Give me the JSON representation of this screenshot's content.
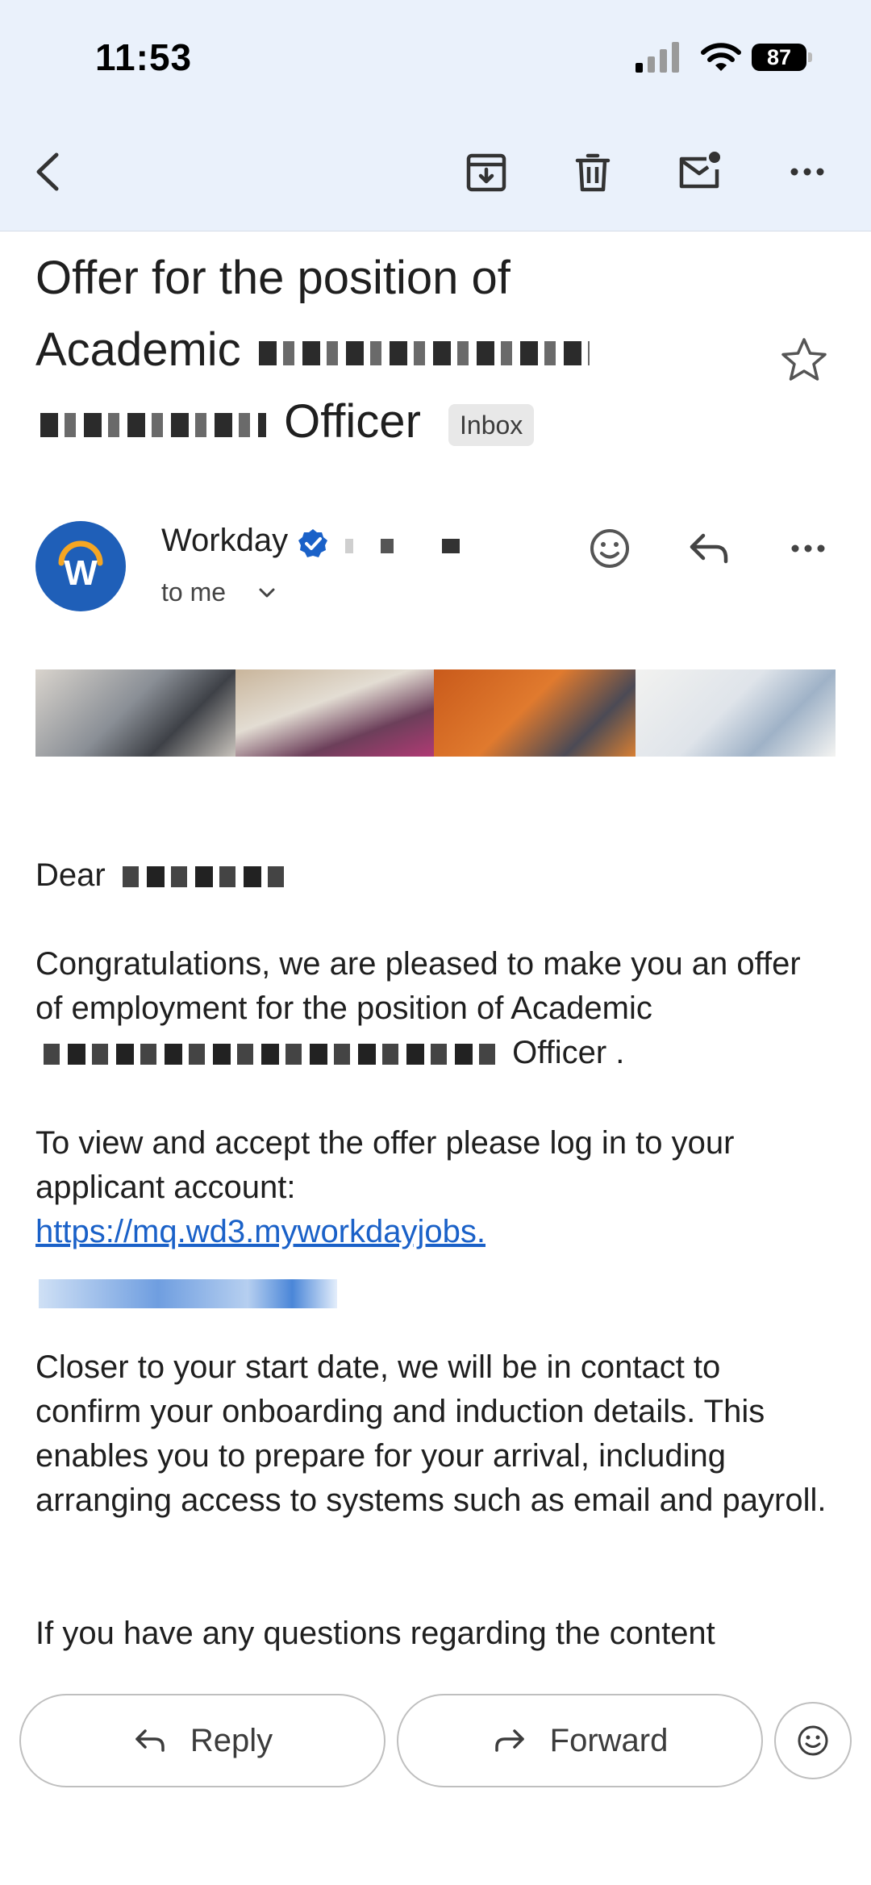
{
  "status_bar": {
    "time": "11:53",
    "battery": "87"
  },
  "toolbar": {
    "back_icon": "back-arrow-icon",
    "archive_icon": "archive-icon",
    "delete_icon": "trash-icon",
    "mark_unread_icon": "mark-unread-icon",
    "more_icon": "more-horizontal-icon"
  },
  "subject": {
    "line1": "Offer for the position of",
    "line2": "Academic",
    "line3": "Officer",
    "label": "Inbox"
  },
  "sender": {
    "avatar_letter": "W",
    "name": "Workday",
    "recipient": "to me"
  },
  "body": {
    "greeting": "Dear",
    "p1_start": "Congratulations, we are pleased to make you an offer of employment for the position of Academic",
    "p1_end": "Officer .",
    "p2": "To view and accept the offer please log in to your applicant account:",
    "link": "https://mq.wd3.myworkdayjobs.",
    "p3": "Closer to your start date, we will be in contact to confirm your onboarding and induction details. This enables you to prepare for your arrival, including arranging access to systems such as email and payroll.",
    "p4": "If you have any questions regarding the content"
  },
  "actions": {
    "reply": "Reply",
    "forward": "Forward"
  },
  "colors": {
    "header_bg": "#eaf1fb",
    "link": "#1a61c8",
    "avatar_bg": "#1f5fb8"
  }
}
